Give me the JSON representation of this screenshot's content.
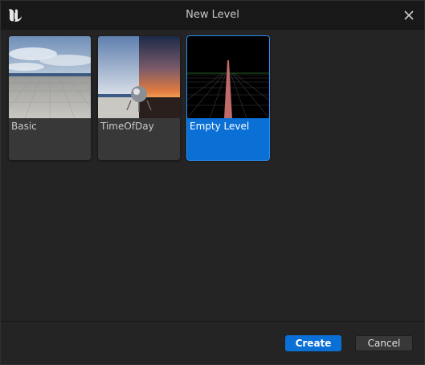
{
  "window": {
    "title": "New Level",
    "logo_icon": "unreal-engine-logo-icon",
    "close_icon": "close-icon"
  },
  "templates": [
    {
      "label": "Basic",
      "thumbnail": "basic-scene-thumbnail",
      "selected": false
    },
    {
      "label": "TimeOfDay",
      "thumbnail": "time-of-day-scene-thumbnail",
      "selected": false
    },
    {
      "label": "Empty Level",
      "thumbnail": "empty-level-grid-thumbnail",
      "selected": true
    }
  ],
  "footer": {
    "create_label": "Create",
    "cancel_label": "Cancel"
  },
  "colors": {
    "accent": "#0a70d6",
    "background": "#242424",
    "titlebar": "#181818",
    "tile": "#383838"
  }
}
